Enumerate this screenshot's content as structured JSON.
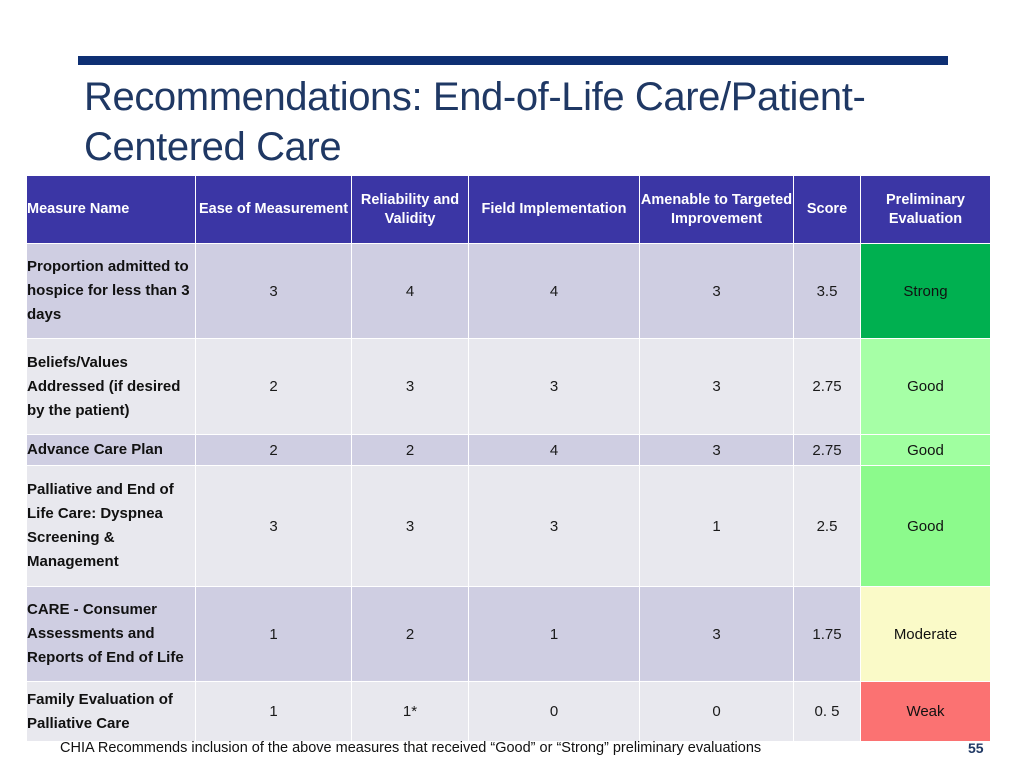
{
  "slide": {
    "title": "Recommendations: End-of-Life Care/Patient-Centered Care",
    "accent_color": "#0E2F73",
    "title_color": "#1F3864",
    "footer_note": "CHIA Recommends inclusion of the above measures that received “Good” or “Strong” preliminary evaluations",
    "page_number": "55"
  },
  "table": {
    "header_color": "#3B36A5",
    "band_dark_color": "#CFCEE2",
    "band_light_color": "#E8E8EE",
    "columns": [
      "Measure Name",
      "Ease of Measurement",
      "Reliability and Validity",
      "Field Implementation",
      "Amenable to Targeted Improvement",
      "Score",
      "Preliminary Evaluation"
    ],
    "rows": [
      {
        "name": "Proportion admitted to hospice for less than 3 days",
        "ease": "3",
        "reliability": "4",
        "field": "4",
        "amenable": "3",
        "score": "3.5",
        "evaluation": "Strong",
        "evaluation_color": "#00B050"
      },
      {
        "name": "Beliefs/Values Addressed (if desired by the patient)",
        "ease": "2",
        "reliability": "3",
        "field": "3",
        "amenable": "3",
        "score": "2.75",
        "evaluation": "Good",
        "evaluation_color": "#A6FFA6"
      },
      {
        "name": "Advance Care Plan",
        "ease": "2",
        "reliability": "2",
        "field": "4",
        "amenable": "3",
        "score": "2.75",
        "evaluation": "Good",
        "evaluation_color": "#A0FFA0"
      },
      {
        "name": "Palliative and End of Life Care: Dyspnea Screening & Management",
        "ease": "3",
        "reliability": "3",
        "field": "3",
        "amenable": "1",
        "score": "2.5",
        "evaluation": "Good",
        "evaluation_color": "#8CFA8C"
      },
      {
        "name": "CARE - Consumer Assessments and Reports of End of Life",
        "ease": "1",
        "reliability": "2",
        "field": "1",
        "amenable": "3",
        "score": "1.75",
        "evaluation": "Moderate",
        "evaluation_color": "#FAFAC8"
      },
      {
        "name": "Family Evaluation of Palliative Care",
        "ease": "1",
        "reliability": "1*",
        "field": "0",
        "amenable": "0",
        "score": "0. 5",
        "evaluation": "Weak",
        "evaluation_color": "#FB7272"
      }
    ]
  }
}
